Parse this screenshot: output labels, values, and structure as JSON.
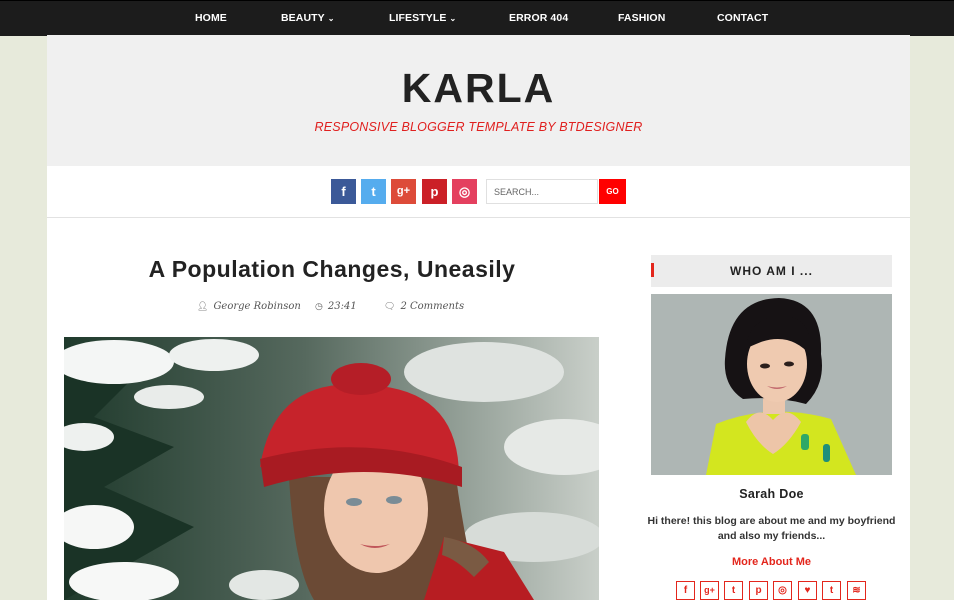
{
  "nav": {
    "items": [
      {
        "label": "HOME",
        "dropdown": false
      },
      {
        "label": "BEAUTY",
        "dropdown": true
      },
      {
        "label": "LIFESTYLE",
        "dropdown": true
      },
      {
        "label": "ERROR 404",
        "dropdown": false
      },
      {
        "label": "FASHION",
        "dropdown": false
      },
      {
        "label": "CONTACT",
        "dropdown": false
      }
    ]
  },
  "header": {
    "title": "KARLA",
    "tagline": "RESPONSIVE BLOGGER TEMPLATE BY BTDESIGNER"
  },
  "social": [
    {
      "icon": "facebook-icon",
      "glyph": "f",
      "color": "#3b5998"
    },
    {
      "icon": "twitter-icon",
      "glyph": "t",
      "color": "#55acee"
    },
    {
      "icon": "google-plus-icon",
      "glyph": "g+",
      "color": "#dd4b39"
    },
    {
      "icon": "pinterest-icon",
      "glyph": "p",
      "color": "#cb2027"
    },
    {
      "icon": "instagram-icon",
      "glyph": "◎",
      "color": "#e4405f"
    }
  ],
  "search": {
    "placeholder": "SEARCH...",
    "button": "GO"
  },
  "post": {
    "title": "A Population Changes, Uneasily",
    "author": "George Robinson",
    "time": "23:41",
    "comments": "2 Comments"
  },
  "sidebar": {
    "widget_title": "WHO AM I ...",
    "name": "Sarah Doe",
    "bio": "Hi there! this blog are about me and my boyfriend and also my friends...",
    "more_link": "More About Me",
    "icons": [
      {
        "icon": "facebook-icon",
        "glyph": "f"
      },
      {
        "icon": "google-plus-icon",
        "glyph": "g+"
      },
      {
        "icon": "twitter-icon",
        "glyph": "t"
      },
      {
        "icon": "pinterest-icon",
        "glyph": "p"
      },
      {
        "icon": "instagram-icon",
        "glyph": "◎"
      },
      {
        "icon": "heart-icon",
        "glyph": "♥"
      },
      {
        "icon": "tumblr-icon",
        "glyph": "t"
      },
      {
        "icon": "rss-icon",
        "glyph": "≋"
      }
    ]
  },
  "colors": {
    "accent": "#e3261c",
    "nav_bg": "#1c1c1c",
    "page_bg": "#e7eadb"
  }
}
